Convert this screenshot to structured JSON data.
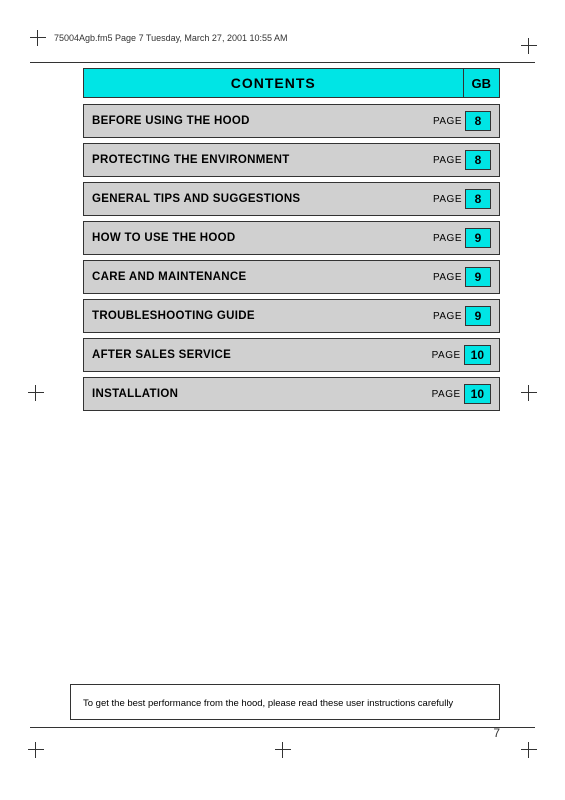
{
  "header": {
    "filename": "75004Agb.fm5  Page 7  Tuesday, March 27, 2001  10:55 AM"
  },
  "contents": {
    "title": "CONTENTS",
    "gb_label": "GB"
  },
  "toc": {
    "rows": [
      {
        "label": "BEFORE USING THE HOOD",
        "page_label": "PAGE",
        "page_num": "8"
      },
      {
        "label": "PROTECTING THE ENVIRONMENT",
        "page_label": "PAGE",
        "page_num": "8"
      },
      {
        "label": "GENERAL TIPS AND SUGGESTIONS",
        "page_label": "PAGE",
        "page_num": "8"
      },
      {
        "label": "HOW TO USE THE HOOD",
        "page_label": "PAGE",
        "page_num": "9"
      },
      {
        "label": "CARE AND MAINTENANCE",
        "page_label": "PAGE",
        "page_num": "9"
      },
      {
        "label": "TROUBLESHOOTING GUIDE",
        "page_label": "PAGE",
        "page_num": "9"
      },
      {
        "label": "AFTER SALES SERVICE",
        "page_label": "PAGE",
        "page_num": "10"
      },
      {
        "label": "INSTALLATION",
        "page_label": "PAGE",
        "page_num": "10"
      }
    ]
  },
  "footer": {
    "note": "To get the best performance from the hood, please read these user instructions carefully"
  },
  "page_number": "7"
}
